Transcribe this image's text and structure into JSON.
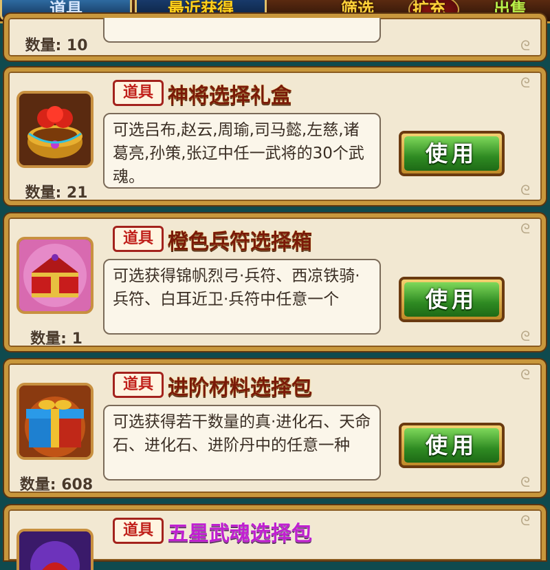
{
  "topbar": {
    "tab_items": "道具",
    "tab_recent": "最近获得",
    "filter": "筛选",
    "expand": "扩充",
    "sell": "出售"
  },
  "partial_item": {
    "qty": "数量: 10"
  },
  "items": [
    {
      "tag": "道具",
      "name": "神将选择礼盒",
      "desc": "可选吕布,赵云,周瑜,司马懿,左慈,诸葛亮,孙策,张辽中任一武将的30个武魂。",
      "qty": "数量: 21",
      "button": "使用",
      "icon": "red-gold-gift-chest-icon"
    },
    {
      "tag": "道具",
      "name": "橙色兵符选择箱",
      "desc": "可选获得锦帆烈弓·兵符、西凉铁骑·兵符、白耳近卫·兵符中任意一个",
      "qty": "数量: 1",
      "button": "使用",
      "icon": "red-treasure-chest-icon"
    },
    {
      "tag": "道具",
      "name": "进阶材料选择包",
      "desc": "可选获得若干数量的真·进化石、天命石、进化石、进阶丹中的任意一种",
      "qty": "数量: 608",
      "button": "使用",
      "icon": "blue-gift-box-icon"
    },
    {
      "tag": "道具",
      "name": "五星武魂选择包",
      "icon": "purple-soul-pack-icon"
    }
  ],
  "colors": {
    "background": "#0f4a4e",
    "card_fill": "#f2e8d2",
    "card_border": "#c8973c",
    "name_color": "#7a1a08",
    "name_purple": "#c020d0",
    "button_green": "#2e8a22"
  }
}
